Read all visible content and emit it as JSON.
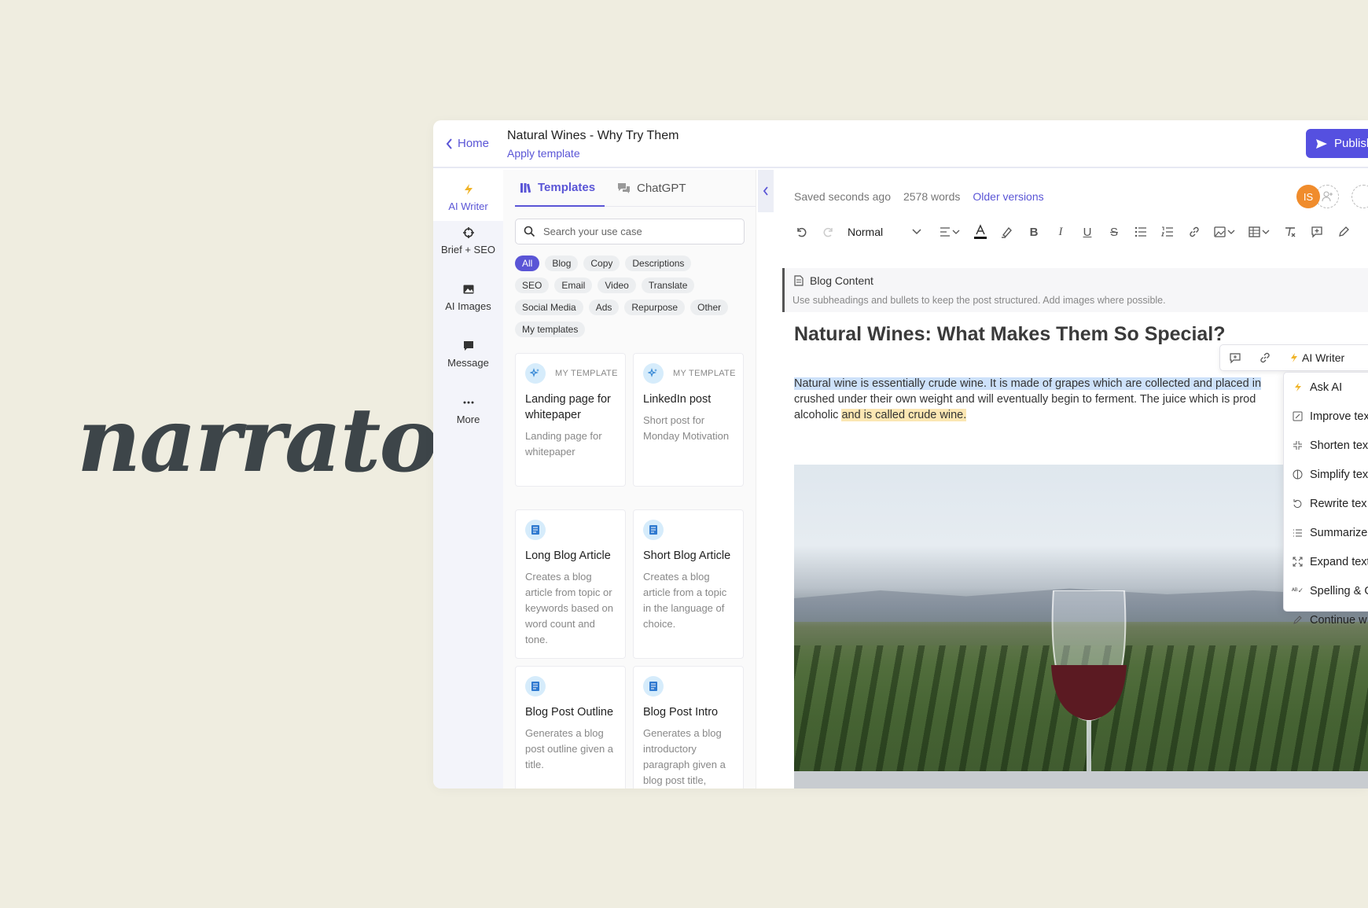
{
  "brand": {
    "logo_text": "narrato"
  },
  "header": {
    "home_label": "Home",
    "doc_title": "Natural Wines - Why Try Them",
    "apply_template": "Apply template",
    "publish_label": "Publish"
  },
  "rail": [
    {
      "label": "AI Writer",
      "icon": "lightning-icon"
    },
    {
      "label": "Brief + SEO",
      "icon": "crosshair-icon"
    },
    {
      "label": "AI Images",
      "icon": "image-icon"
    },
    {
      "label": "Message",
      "icon": "chat-bubble-icon"
    },
    {
      "label": "More",
      "icon": "ellipsis-icon"
    }
  ],
  "panel": {
    "tabs": [
      {
        "label": "Templates",
        "active": true
      },
      {
        "label": "ChatGPT",
        "active": false
      }
    ],
    "search_placeholder": "Search your use case",
    "chips": [
      [
        "All",
        "Blog",
        "Copy",
        "Descriptions"
      ],
      [
        "SEO",
        "Email",
        "Video",
        "Translate"
      ],
      [
        "Social Media",
        "Ads",
        "Repurpose",
        "Other"
      ],
      [
        "My templates"
      ]
    ],
    "cards": [
      {
        "tag": "MY TEMPLATE",
        "title": "Landing page for whitepaper",
        "desc": "Landing page for whitepaper"
      },
      {
        "tag": "MY TEMPLATE",
        "title": "LinkedIn post",
        "desc": "Short post for Monday Motivation"
      },
      {
        "tag": "",
        "title": "Long Blog Article",
        "desc": "Creates a blog article from topic or keywords based on word count and tone."
      },
      {
        "tag": "",
        "title": "Short Blog Article",
        "desc": "Creates a blog article from a topic in the language of choice."
      },
      {
        "tag": "",
        "title": "Blog Post Outline",
        "desc": "Generates a blog post outline given a title."
      },
      {
        "tag": "",
        "title": "Blog Post Intro",
        "desc": "Generates a blog introductory paragraph given a blog post title,"
      }
    ]
  },
  "editor": {
    "saved": "Saved seconds ago",
    "words": "2578 words",
    "older_versions": "Older versions",
    "avatar_initials": "IS",
    "style_select": "Normal",
    "brief_title": "Blog Content",
    "brief_desc": "Use subheadings and bullets to keep the post structured. Add images where possible.",
    "heading": "Natural Wines: What Makes Them So Special?",
    "ai_writer_label": "AI Writer",
    "para_line1": "Natural wine is essentially crude wine. It is made of grapes which are collected and placed in",
    "para_line2": "crushed under their own weight and will eventually begin to ferment. The juice which is prod",
    "para_line3a": "alcoholic ",
    "para_line3b": "and is called crude wine."
  },
  "ai_menu": [
    {
      "label": "Ask AI",
      "icon": "lightning-icon"
    },
    {
      "label": "Improve tex",
      "icon": "edit-box-icon"
    },
    {
      "label": "Shorten tex",
      "icon": "shrink-icon"
    },
    {
      "label": "Simplify tex",
      "icon": "half-circle-icon"
    },
    {
      "label": "Rewrite tex",
      "icon": "rotate-icon"
    },
    {
      "label": "Summarize",
      "icon": "list-icon"
    },
    {
      "label": "Expand text",
      "icon": "expand-icon"
    },
    {
      "label": "Spelling & G",
      "icon": "spellcheck-icon"
    },
    {
      "label": "Continue w",
      "icon": "pencil-icon"
    }
  ],
  "colors": {
    "accent": "#5a55d6",
    "publish": "#5550e0",
    "avatar": "#f08c2c",
    "background": "#efede0"
  }
}
